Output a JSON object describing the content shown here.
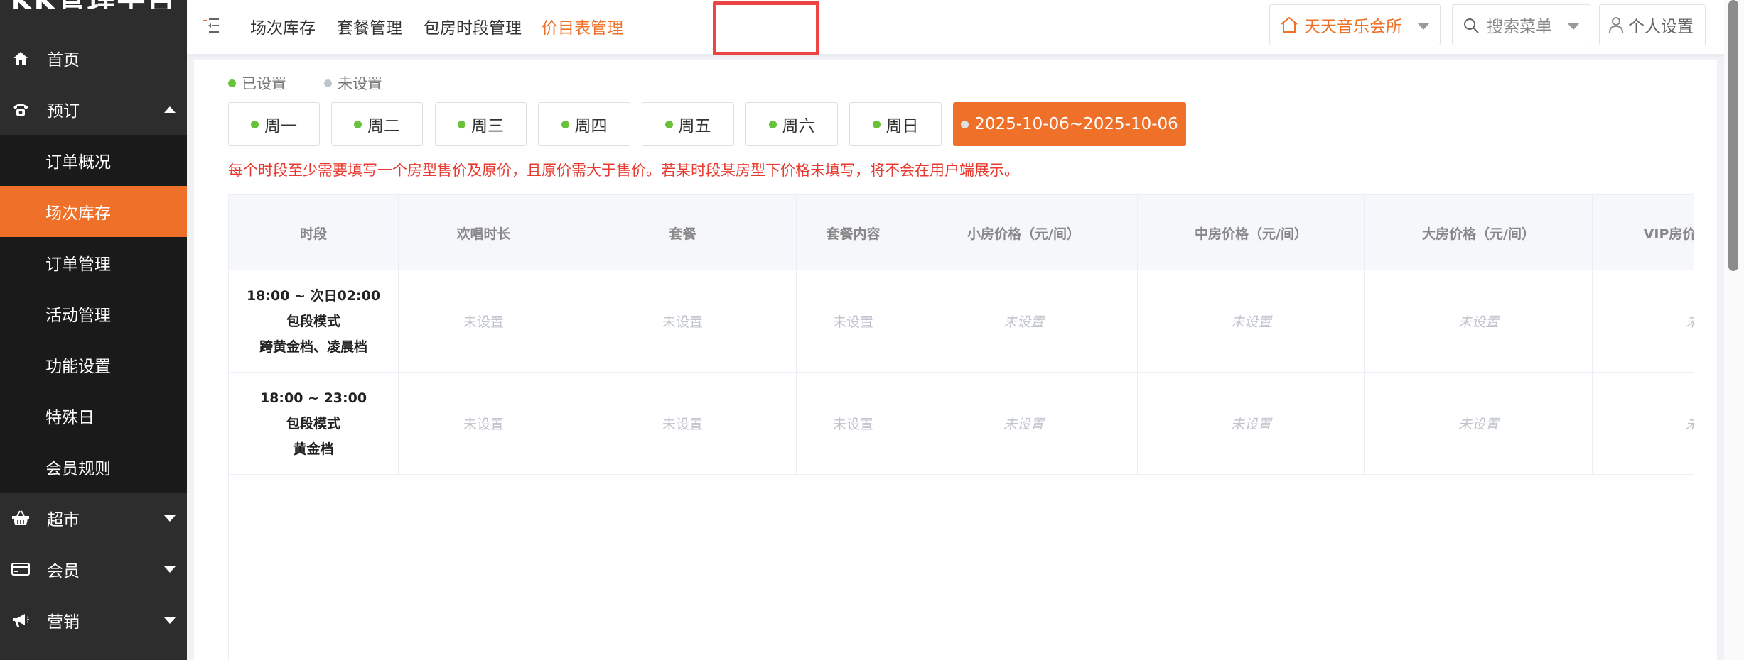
{
  "sidebar": {
    "logo_text": "KK管理平台",
    "items": [
      {
        "label": "首页",
        "icon": "home-icon"
      },
      {
        "label": "预订",
        "icon": "phone-icon"
      },
      {
        "label": "订单概况"
      },
      {
        "label": "场次库存"
      },
      {
        "label": "订单管理"
      },
      {
        "label": "活动管理"
      },
      {
        "label": "功能设置"
      },
      {
        "label": "特殊日"
      },
      {
        "label": "会员规则"
      },
      {
        "label": "超市",
        "icon": "basket-icon"
      },
      {
        "label": "会员",
        "icon": "card-icon"
      },
      {
        "label": "营销",
        "icon": "megaphone-icon"
      }
    ]
  },
  "topbar": {
    "tabs": [
      "场次库存",
      "套餐管理",
      "包房时段管理",
      "价目表管理"
    ],
    "active_tab": "价目表管理",
    "store": "天天音乐会所",
    "search_placeholder": "搜索菜单",
    "personal": "个人设置"
  },
  "legend": {
    "set": "已设置",
    "unset": "未设置"
  },
  "days": [
    "周一",
    "周二",
    "周三",
    "周四",
    "周五",
    "周六",
    "周日",
    "2025-10-06~2025-10-06"
  ],
  "notice": "每个时段至少需要填写一个房型售价及原价，且原价需大于售价。若某时段某房型下价格未填写，将不会在用户端展示。",
  "table": {
    "headers": [
      "时段",
      "欢唱时长",
      "套餐",
      "套餐内容",
      "小房价格（元/间）",
      "中房价格（元/间）",
      "大房价格（元/间）",
      "VIP房价格（元/间）"
    ],
    "rows": [
      {
        "time": "18:00 ~ 次日02:00",
        "mode": "包段模式",
        "tier": "跨黄金档、凌晨档",
        "cells": [
          "未设置",
          "未设置",
          "未设置",
          "未设置",
          "未设置",
          "未设置",
          "未设置"
        ]
      },
      {
        "time": "18:00 ~ 23:00",
        "mode": "包段模式",
        "tier": "黄金档",
        "cells": [
          "未设置",
          "未设置",
          "未设置",
          "未设置",
          "未设置",
          "未设置",
          "未设置"
        ]
      }
    ]
  },
  "colors": {
    "accent": "#ef7029",
    "sidebar_bg": "#2d2d2d",
    "set_dot": "#67c23a",
    "notice": "#e83a30"
  }
}
